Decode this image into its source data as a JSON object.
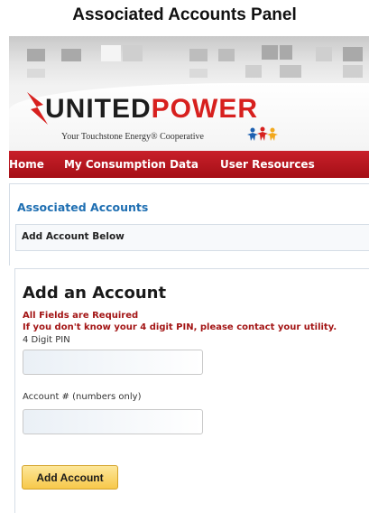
{
  "caption": "Associated Accounts Panel",
  "header": {
    "brand_part1": "UNITED",
    "brand_part2": "POWER",
    "tagline": "Your Touchstone Energy® Cooperative"
  },
  "nav": {
    "items": [
      {
        "label": "Home"
      },
      {
        "label": "My Consumption Data"
      },
      {
        "label": "User Resources"
      }
    ]
  },
  "panel": {
    "title": "Associated Accounts",
    "subheader": "Add Account Below"
  },
  "form": {
    "title": "Add an Account",
    "required_note": "All Fields are Required",
    "pin_note": "If you don't know your 4 digit PIN, please contact your utility.",
    "pin_label": "4 Digit PIN",
    "pin_value": "",
    "account_label": "Account # (numbers only)",
    "account_value": "",
    "submit_label": "Add Account"
  },
  "colors": {
    "brand_red": "#d7201e",
    "nav_red": "#b8161e",
    "link_blue": "#1f6fb2",
    "button_gold": "#f7c84a"
  },
  "icons": [
    "lightning-bolt-icon",
    "touchstone-people-icon"
  ]
}
